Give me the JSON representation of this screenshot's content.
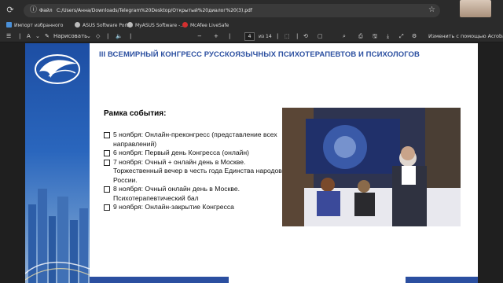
{
  "browser": {
    "file_label": "Файл",
    "url": "C:/Users/Анна/Downloads/Telegram%20Desktop/Открытый%20диалог%20(3).pdf"
  },
  "bookmarks": [
    {
      "label": "Импорт избранного",
      "color": "#4a90d9"
    },
    {
      "label": "ASUS Software Port...",
      "color": "#bbbbbb"
    },
    {
      "label": "MyASUS Software -...",
      "color": "#bbbbbb"
    },
    {
      "label": "McAfee LiveSafe",
      "color": "#d32f2f"
    }
  ],
  "pdf_toolbar": {
    "draw_label": "Нарисовать",
    "page_current": "4",
    "page_total": "из 14",
    "acrobat_label": "Изменить с помощью Acrobat"
  },
  "slide": {
    "title": "III ВСЕМИРНЫЙ КОНГРЕСС РУССКОЯЗЫЧНЫХ ПСИХОТЕРАПЕВТОВ И ПСИХОЛОГОВ",
    "frame_title": "Рамка события:",
    "items": [
      "5 ноября: Онлайн-преконгресс (представление всех направлений)",
      "6 ноября: Первый день Конгресса (онлайн)",
      "7 ноября: Очный + онлайн день в Москве. Торжественный вечер  в честь года Единства народов России.",
      "8 ноября: Очный онлайн день в Москве. Психотерапевтический бал",
      "9 ноября: Онлайн-закрытие Конгресса"
    ]
  },
  "colors": {
    "title_blue": "#2b4fa0",
    "band_blue": "#1d4ea3"
  }
}
